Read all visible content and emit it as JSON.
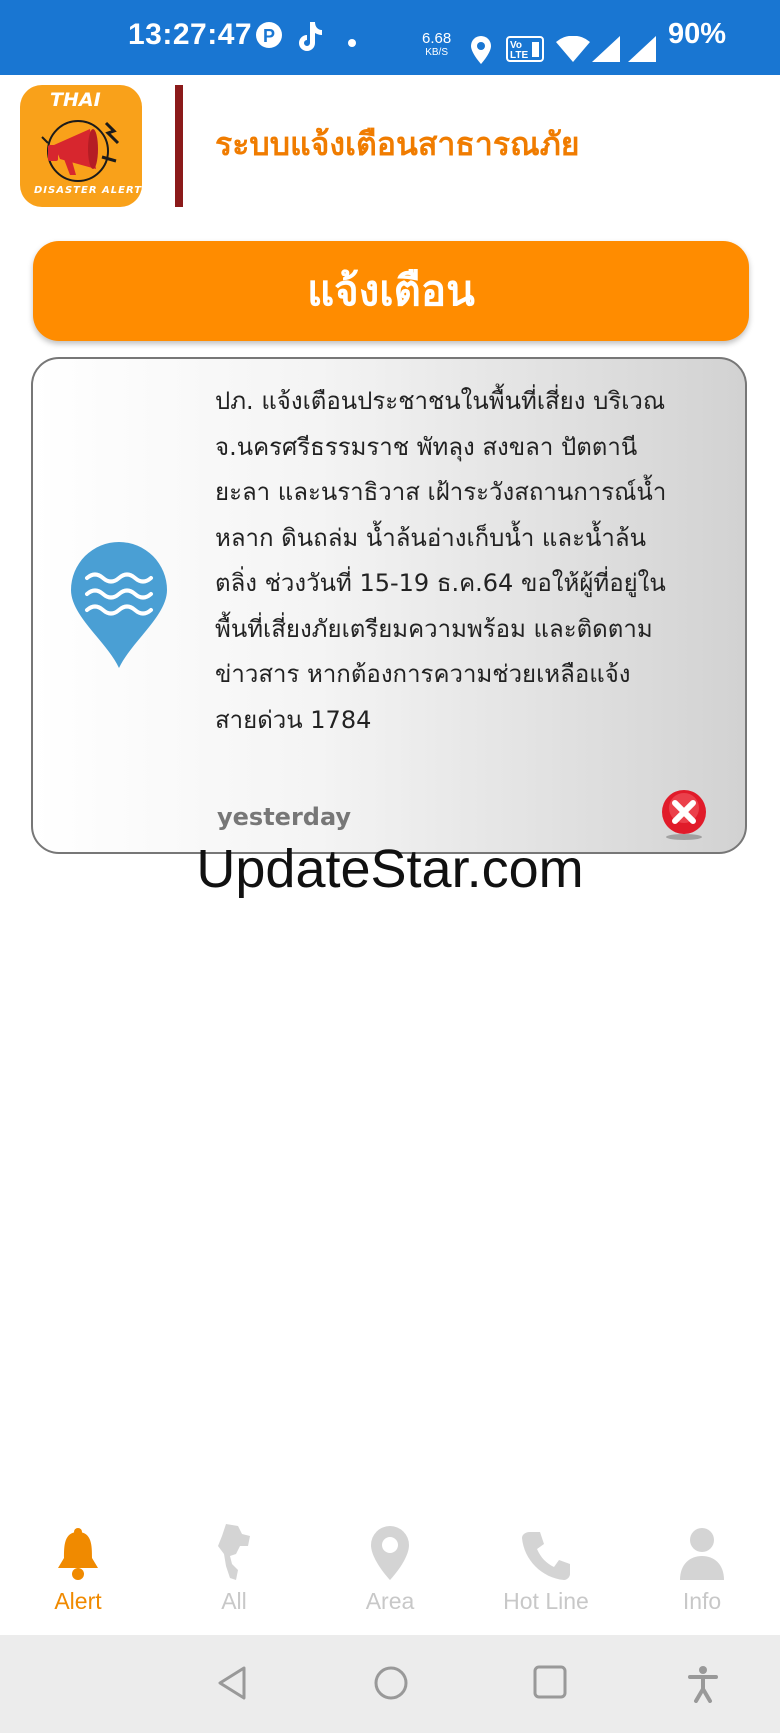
{
  "status_bar": {
    "time": "13:27:47",
    "net_speed": "6.68",
    "net_unit": "KB/S",
    "battery": "90%",
    "icons": [
      "notification-p-icon",
      "tiktok-icon",
      "dot-icon",
      "location-icon",
      "volte-icon",
      "wifi-icon",
      "signal-icon",
      "signal-icon-2"
    ]
  },
  "header": {
    "logo_text": "THAI",
    "logo_subtext": "DISASTER ALERT",
    "title": "ระบบแจ้งเตือนสาธารณภัย"
  },
  "alert_header": {
    "label": "แจ้งเตือน"
  },
  "alerts": [
    {
      "icon": "flood-pin-icon",
      "message": "ปภ. แจ้งเตือนประชาชนในพื้นที่เสี่ยง บริเวณ\nจ.นครศรีธรรมราช พัทลุง สงขลา ปัตตานี\nยะลา และนราธิวาส เฝ้าระวังสถานการณ์น้ำ\nหลาก ดินถล่ม น้ำล้นอ่างเก็บน้ำ และน้ำล้น\nตลิ่ง ช่วงวันที่ 15-19 ธ.ค.64 ขอให้ผู้ที่อยู่ใน\nพื้นที่เสี่ยงภัยเตรียมความพร้อม และติดตาม\nข่าวสาร หากต้องการความช่วยเหลือแจ้ง\nสายด่วน 1784",
      "time": "yesterday"
    }
  ],
  "watermark": "UpdateStar.com",
  "bottom_nav": {
    "items": [
      {
        "label": "Alert",
        "icon": "bell-icon",
        "active": true
      },
      {
        "label": "All",
        "icon": "thailand-map-icon",
        "active": false
      },
      {
        "label": "Area",
        "icon": "map-pin-icon",
        "active": false
      },
      {
        "label": "Hot Line",
        "icon": "phone-icon",
        "active": false
      },
      {
        "label": "Info",
        "icon": "user-icon",
        "active": false
      }
    ]
  },
  "colors": {
    "status_bar": "#1976d2",
    "accent": "#ff8c00",
    "title": "#f07c00",
    "divider": "#8b1a1a",
    "inactive": "#c8c8c8"
  }
}
